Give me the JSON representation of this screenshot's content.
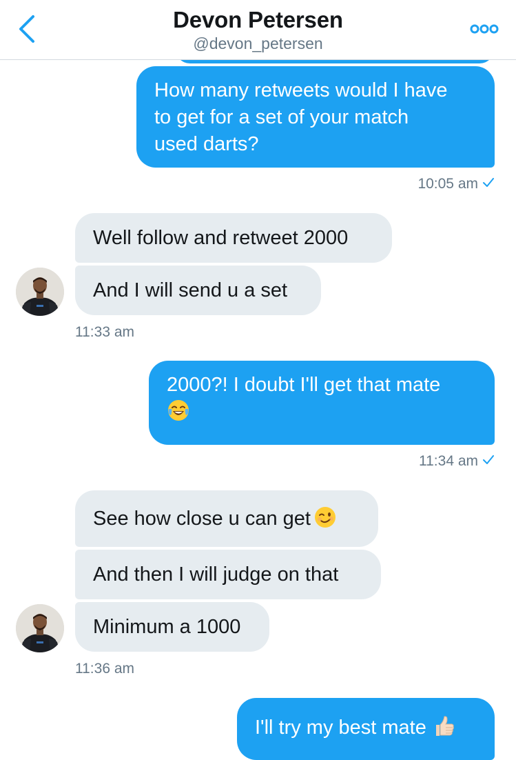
{
  "header": {
    "name": "Devon Petersen",
    "handle": "@devon_petersen"
  },
  "colors": {
    "accent": "#1da1f2",
    "incoming_bubble": "#e6ecf0",
    "meta_text": "#657786"
  },
  "icons": {
    "back": "chevron-left-icon",
    "more": "more-dots-icon",
    "read": "checkmark-icon",
    "laugh": "face-with-tears-of-joy-emoji",
    "wink": "winking-face-emoji",
    "thumbs": "thumbs-up-emoji"
  },
  "messages": [
    {
      "direction": "out",
      "lines": [
        "How many retweets would I have",
        "to get for a set of your match",
        "used darts?"
      ]
    },
    {
      "direction": "in",
      "text": "Well follow and retweet 2000"
    },
    {
      "direction": "in",
      "text": "And I will send u a set"
    },
    {
      "direction": "out",
      "lines": [
        "2000?! I doubt I'll get that mate"
      ]
    },
    {
      "direction": "in",
      "text": "See how close u can get"
    },
    {
      "direction": "in",
      "text": "And then I will judge on that"
    },
    {
      "direction": "in",
      "text": "Minimum a 1000"
    },
    {
      "direction": "out",
      "text": "I'll try my best mate"
    }
  ],
  "timestamps": {
    "t1": "10:05 am",
    "t2": "11:33 am",
    "t3": "11:34 am",
    "t4": "11:36 am"
  }
}
